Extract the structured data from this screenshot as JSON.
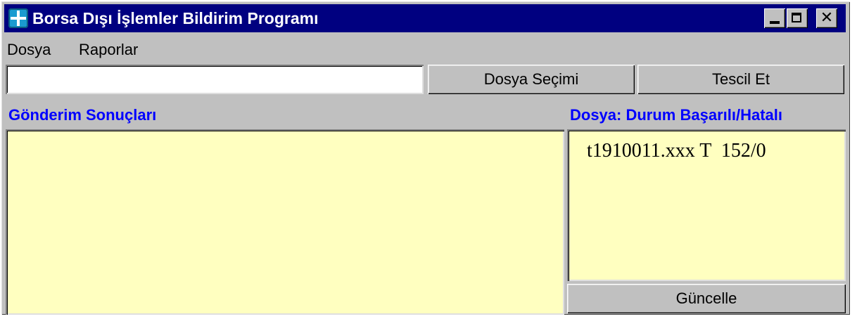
{
  "window": {
    "title": "Borsa Dışı İşlemler Bildirim Programı"
  },
  "menu": {
    "items": [
      "Dosya",
      "Raporlar"
    ]
  },
  "toolbar": {
    "file_path_value": "",
    "select_file_label": "Dosya Seçimi",
    "register_label": "Tescil Et"
  },
  "results": {
    "label": "Gönderim Sonuçları"
  },
  "file_status": {
    "label": "Dosya: Durum Başarılı/Hatalı",
    "entries": [
      "t1910011.xxx T  152/0"
    ],
    "refresh_label": "Güncelle"
  },
  "icons": {
    "app": "app-logo-icon",
    "minimize": "minimize-icon",
    "maximize": "maximize-icon",
    "close": "close-icon"
  },
  "colors": {
    "titlebar": "#000080",
    "section_label": "#0000ff",
    "panel_background": "#ffffc0",
    "window_background": "#c0c0c0"
  }
}
